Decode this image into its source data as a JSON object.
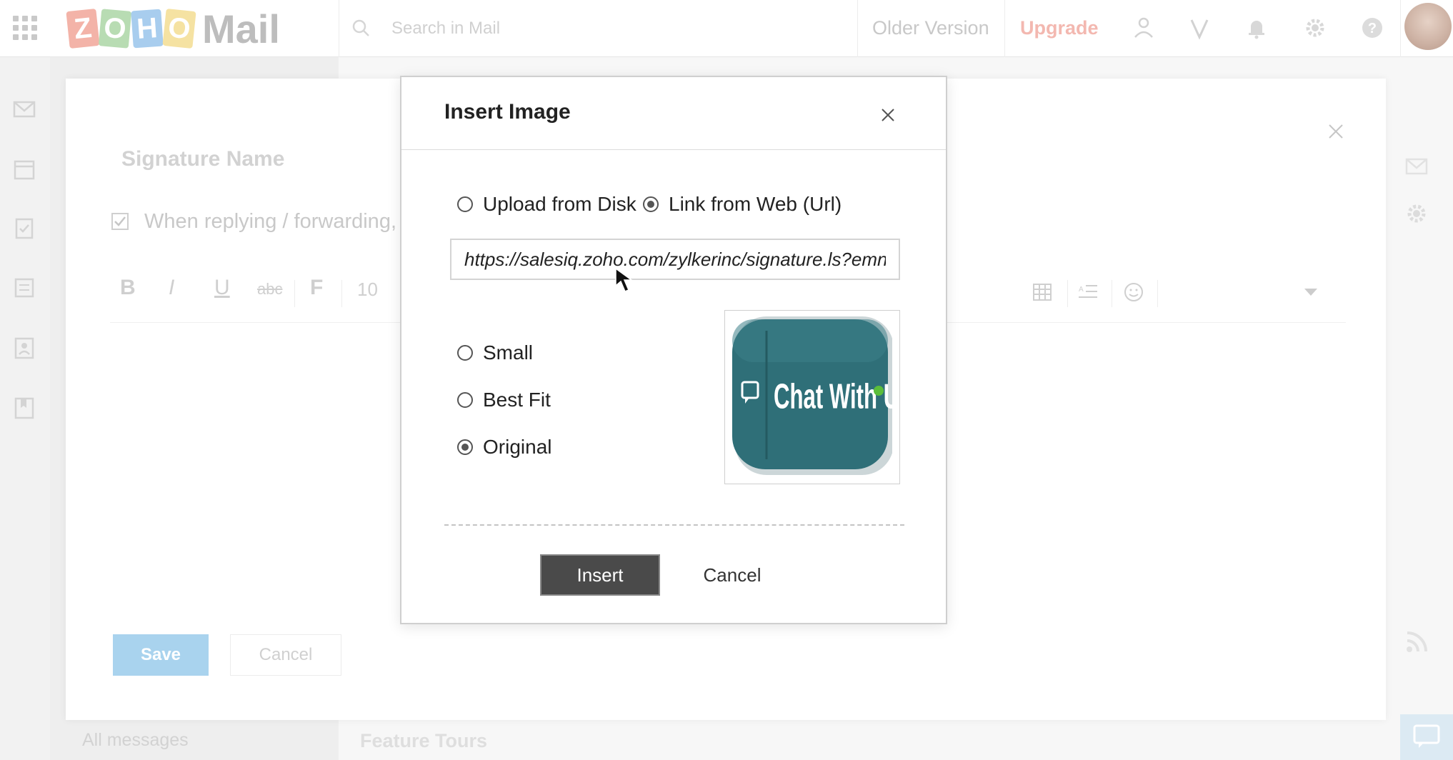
{
  "topbar": {
    "logo_letters": [
      "Z",
      "O",
      "H",
      "O"
    ],
    "logo_colors": [
      "#f3b3a8",
      "#b8dcb3",
      "#a8cdee",
      "#f5e2a2"
    ],
    "logo_product": "Mail",
    "search_placeholder": "Search in Mail",
    "older_version_label": "Older Version",
    "upgrade_label": "Upgrade",
    "icons": [
      "apps-grid-icon",
      "search-icon",
      "people-icon",
      "v-icon",
      "bell-icon",
      "gear-icon",
      "help-icon",
      "avatar"
    ]
  },
  "left_rail": {
    "icons": [
      "mail-icon",
      "calendar-icon",
      "tasks-icon",
      "notes-icon",
      "contacts-icon",
      "bookmarks-icon"
    ]
  },
  "folder_pane": {
    "all_messages_label": "All messages",
    "feature_tours_label": "Feature Tours"
  },
  "signature_editor": {
    "name_placeholder": "Signature Name",
    "reply_checkbox_label": "When replying / forwarding, p",
    "reply_checkbox_checked": true,
    "toolbar": {
      "bold": "B",
      "italic": "I",
      "underline": "U",
      "strikethrough": "abc",
      "font": "F",
      "font_size": "10"
    },
    "save_label": "Save",
    "cancel_label": "Cancel"
  },
  "insert_image_dialog": {
    "title": "Insert Image",
    "source_options": [
      {
        "label": "Upload from Disk",
        "checked": false
      },
      {
        "label": "Link from Web (Url)",
        "checked": true
      }
    ],
    "url_value": "https://salesiq.zoho.com/zylkerinc/signature.ls?emnc",
    "size_options": [
      {
        "label": "Small",
        "checked": false
      },
      {
        "label": "Best Fit",
        "checked": false
      },
      {
        "label": "Original",
        "checked": true
      }
    ],
    "preview_text": "Chat With Us",
    "insert_label": "Insert",
    "cancel_label": "Cancel"
  },
  "colors": {
    "primary_dark_button": "#4a4a4a",
    "save_button": "#a9d3ee",
    "upgrade": "#f3b8b0",
    "chat_button_teal": "#2f6f78",
    "chat_button_green_dot": "#5bbd3a"
  }
}
